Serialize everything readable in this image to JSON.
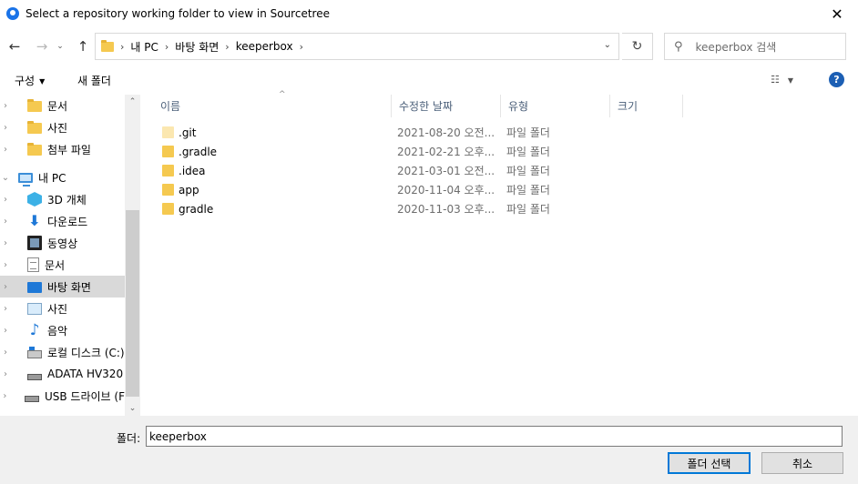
{
  "window": {
    "title": "Select a repository working folder to view in Sourcetree",
    "close_glyph": "✕"
  },
  "nav": {
    "back_glyph": "←",
    "forward_glyph": "→",
    "recent_glyph": "⌄",
    "up_glyph": "↑",
    "breadcrumbs": [
      "내 PC",
      "바탕 화면",
      "keeperbox"
    ],
    "crumb_sep": "›",
    "dropdown_glyph": "⌄",
    "refresh_glyph": "↻",
    "search_placeholder": "keeperbox 검색",
    "search_glyph": "⚲"
  },
  "toolbar": {
    "organize_label": "구성",
    "organize_caret": "▼",
    "new_folder_label": "새 폴더",
    "view_glyph": "☷",
    "view_caret": "▼",
    "help_glyph": "?"
  },
  "tree": [
    {
      "label": "문서",
      "icon": "folder-icon",
      "chevron": "›"
    },
    {
      "label": "사진",
      "icon": "folder-icon",
      "chevron": "›"
    },
    {
      "label": "첨부 파일",
      "icon": "folder-icon",
      "chevron": "›"
    },
    {
      "label": "내 PC",
      "icon": "pc-icon",
      "chevron": "⌄"
    },
    {
      "label": "3D 개체",
      "icon": "3d-objects-icon",
      "chevron": "›"
    },
    {
      "label": "다운로드",
      "icon": "download-icon",
      "chevron": "›"
    },
    {
      "label": "동영상",
      "icon": "video-icon",
      "chevron": "›"
    },
    {
      "label": "문서",
      "icon": "document-icon",
      "chevron": "›"
    },
    {
      "label": "바탕 화면",
      "icon": "desktop-icon",
      "chevron": "›",
      "selected": true
    },
    {
      "label": "사진",
      "icon": "pictures-icon",
      "chevron": "›"
    },
    {
      "label": "음악",
      "icon": "music-icon",
      "chevron": "›"
    },
    {
      "label": "로컬 디스크 (C:)",
      "icon": "local-disk-icon",
      "chevron": "›"
    },
    {
      "label": "ADATA HV320",
      "icon": "drive-icon",
      "chevron": "›"
    },
    {
      "label": "USB 드라이브 (F",
      "icon": "usb-drive-icon",
      "chevron": "›"
    }
  ],
  "scroll": {
    "up_glyph": "⌃",
    "down_glyph": "⌄"
  },
  "columns": {
    "name": "이름",
    "date": "수정한 날짜",
    "type": "유형",
    "size": "크기",
    "sort_glyph": "^"
  },
  "files": [
    {
      "name": ".git",
      "date": "2021-08-20 오전...",
      "type": "파일 폴더",
      "hidden": true
    },
    {
      "name": ".gradle",
      "date": "2021-02-21 오후...",
      "type": "파일 폴더",
      "hidden": false
    },
    {
      "name": ".idea",
      "date": "2021-03-01 오전...",
      "type": "파일 폴더",
      "hidden": false
    },
    {
      "name": "app",
      "date": "2020-11-04 오후...",
      "type": "파일 폴더",
      "hidden": false
    },
    {
      "name": "gradle",
      "date": "2020-11-03 오후...",
      "type": "파일 폴더",
      "hidden": false
    }
  ],
  "footer": {
    "folder_label": "폴더:",
    "folder_value": "keeperbox",
    "select_button": "폴더 선택",
    "cancel_button": "취소"
  },
  "colors": {
    "selection": "#cce8ff",
    "accent": "#0078d7",
    "folder": "#f5c950"
  }
}
